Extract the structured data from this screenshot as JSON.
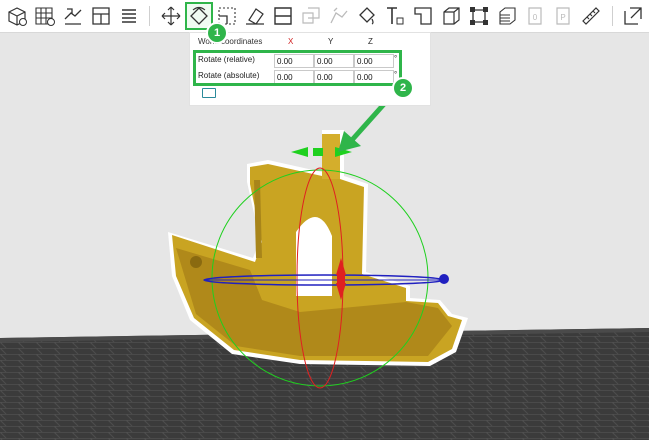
{
  "toolbar": {
    "tools": [
      {
        "name": "add-object-icon"
      },
      {
        "name": "grid-icon"
      },
      {
        "name": "arrange-icon"
      },
      {
        "name": "layout-icon"
      },
      {
        "name": "layers-icon"
      },
      {
        "name": "move-icon"
      },
      {
        "name": "rotate-icon"
      },
      {
        "name": "scale-icon"
      },
      {
        "name": "place-on-face-icon"
      },
      {
        "name": "cut-icon"
      },
      {
        "name": "boolean-icon"
      },
      {
        "name": "hollow-icon"
      },
      {
        "name": "paint-icon"
      },
      {
        "name": "text-icon"
      },
      {
        "name": "support-icon"
      },
      {
        "name": "cube-icon"
      },
      {
        "name": "frame-icon"
      },
      {
        "name": "variable-layer-icon"
      },
      {
        "name": "page-icon"
      },
      {
        "name": "print-icon"
      },
      {
        "name": "measure-icon"
      },
      {
        "name": "export-icon"
      }
    ]
  },
  "rotation_panel": {
    "title": "World coordinates",
    "axis_x": "X",
    "axis_y": "Y",
    "axis_z": "Z",
    "rows": [
      {
        "label": "Rotate (relative)",
        "x": "0.00",
        "y": "0.00",
        "z": "0.00",
        "unit": "°"
      },
      {
        "label": "Rotate (absolute)",
        "x": "0.00",
        "y": "0.00",
        "z": "0.00",
        "unit": "°"
      }
    ]
  },
  "callouts": {
    "first": "1",
    "second": "2"
  },
  "colors": {
    "accent_green": "#2fb54a",
    "model": "#c9a422",
    "bed": "#3a3a3a",
    "axis_red": "#e02020",
    "axis_blue": "#2020c0"
  }
}
